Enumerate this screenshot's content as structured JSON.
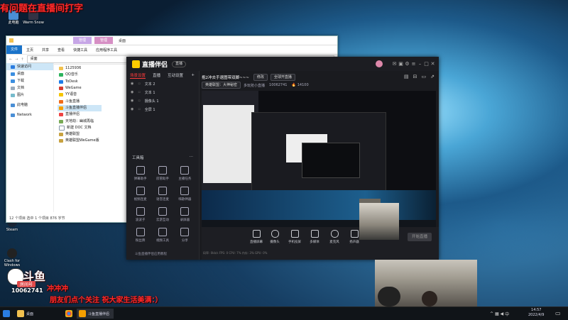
{
  "overlay": {
    "top_text": "有问题在直播间打字",
    "room_label": "房间号",
    "room_number": "10062741",
    "line1": "冲冲冲",
    "line2": "朋友们点个关注 祝大家生活美满：）",
    "badge": "斗鱼"
  },
  "desktop_icons": [
    {
      "name": "此电脑"
    },
    {
      "name": "Warm Snow"
    },
    {
      "name": "Steam"
    },
    {
      "name": "Clash for Windows"
    }
  ],
  "explorer": {
    "ctx_tab_manage": "管理",
    "ctx_tab_manage2": "管理",
    "title": "桌面",
    "ribbon": [
      "文件",
      "主页",
      "共享",
      "查看",
      "快捷工具",
      "应用程序工具"
    ],
    "address": "桌面",
    "nav": [
      "快速访问",
      "桌面",
      "下载",
      "文档",
      "图片",
      "此电脑",
      "Network"
    ],
    "files": [
      "1125936",
      "QQ音乐",
      "ToDesk",
      "WeGame",
      "YY语音",
      "斗鱼直播",
      "斗鱼直播伴侣",
      "直播伴侣",
      "天地劫：幽城再临",
      "新建 DOC 文档",
      "英雄联盟",
      "英雄联盟WeGame版"
    ],
    "status": "12 个项目   选中 1 个项目  876 字节"
  },
  "app": {
    "logo": "直播伴侣",
    "version_pill": "直播",
    "tabs": [
      "场景设置",
      "直播",
      "互动设置"
    ],
    "scenes": [
      "文本 2",
      "文本 1",
      "摄像头 1",
      "全屏 1"
    ],
    "room_title": "抱2冲去手速图带双脚~~~",
    "edit_btn": "修改",
    "category": "全球开直播",
    "mode_btn": "英雄联盟：大神秘密",
    "category2": "多玩抢小直播",
    "room_id": "10062741",
    "viewers": "14100",
    "tools_title": "工具箱",
    "tools": [
      "弹幕助手",
      "房管助手",
      "主播任务",
      "视频连麦",
      "语音连麦",
      "嗨歌神器",
      "波波子",
      "云游互动",
      "录屏器",
      "粉丝牌",
      "视频工具",
      "分享"
    ],
    "promo": "斗鱼直播伴侣应用教程",
    "bottom": [
      "直播屏幕",
      "摄像头",
      "手机投屏",
      "多媒体",
      "麦克风",
      "扬声器"
    ],
    "start_live": "开始直播",
    "stats": "码率: 0kb/s  FPS: 0  CPU: 7%  内存: 3%  GPU: 0%"
  },
  "taskbar": {
    "items": [
      "桌面",
      "斗鱼直播伴侣"
    ],
    "time": "14:57",
    "date": "2022/4/9",
    "lang": "中"
  }
}
